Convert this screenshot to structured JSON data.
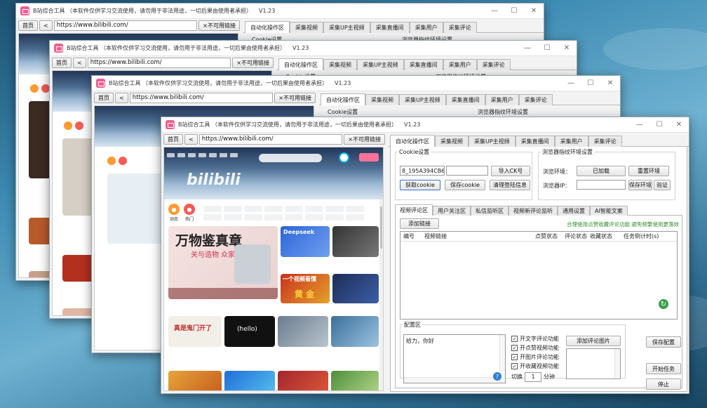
{
  "app": {
    "title": "B站综合工具 （本软件仅供学习交流使用，请勿用于非法用途，一切后果由使用者承担）",
    "version": "V1.23",
    "minimize": "—",
    "maximize": "☐",
    "close": "✕"
  },
  "nav": {
    "home": "首页",
    "back": "<",
    "url": "https://www.bilibili.com/",
    "no_link": "×不可用链接"
  },
  "tabs": [
    "自动化操作区",
    "采集视频",
    "采集UP主视频",
    "采集直播间",
    "采集用户",
    "采集评论"
  ],
  "cookie": {
    "legend": "Cookie设置",
    "value": "8_195A394CB61;",
    "import_btn": "导入CK号",
    "get_btn": "获取cookie",
    "save_btn": "保存cookie",
    "clear_btn": "清理登陆信息"
  },
  "env": {
    "legend": "浏览器指纹环境设置",
    "env_label": "浏览环境：",
    "env_value": "已加载",
    "reset_btn": "重置环境",
    "ip_label": "浏览器IP：",
    "save_env_btn": "保存环境",
    "verify_btn": "验证"
  },
  "subtabs": [
    "视频评论区",
    "用户关注区",
    "私信监听区",
    "视频新评论监听",
    "通用设置",
    "AI智能文案"
  ],
  "comment_area": {
    "add_link_btn": "添加链接",
    "notice": "合理使用点赞收藏评论功能 避免频繁使用更落效",
    "columns": [
      "编号",
      "视频链接",
      "点赞状态",
      "评论状态",
      "收藏状态",
      "任务倒计时(s)"
    ]
  },
  "config": {
    "legend": "配置区",
    "comment_text": "给力，你好",
    "options": [
      "开文字评论功能",
      "开点赞视频功能",
      "开图片评论功能",
      "开收藏视频功能"
    ],
    "add_image_btn": "添加评论图片",
    "switch_label": "切换",
    "switch_value": "1",
    "switch_unit": "分钟",
    "save_config_btn": "保存配置",
    "start_btn": "开始任务",
    "stop_btn": "停止"
  },
  "bili_feed": {
    "big_card_title": "万物鉴真章",
    "big_card_sub": "关与造物 众家鉴真道",
    "logo": "bilibili",
    "channel_labels": [
      "动态",
      "热门"
    ],
    "card_texts": [
      "Deepseek",
      "一个视频看懂",
      "真是鬼门开了",
      "(hello)",
      "黄 金"
    ]
  },
  "colors": {
    "accent_green": "#2c8b2c",
    "bili_pink": "#fb7299",
    "bili_blue": "#00aeec",
    "app_logo": "#f25d8e"
  }
}
